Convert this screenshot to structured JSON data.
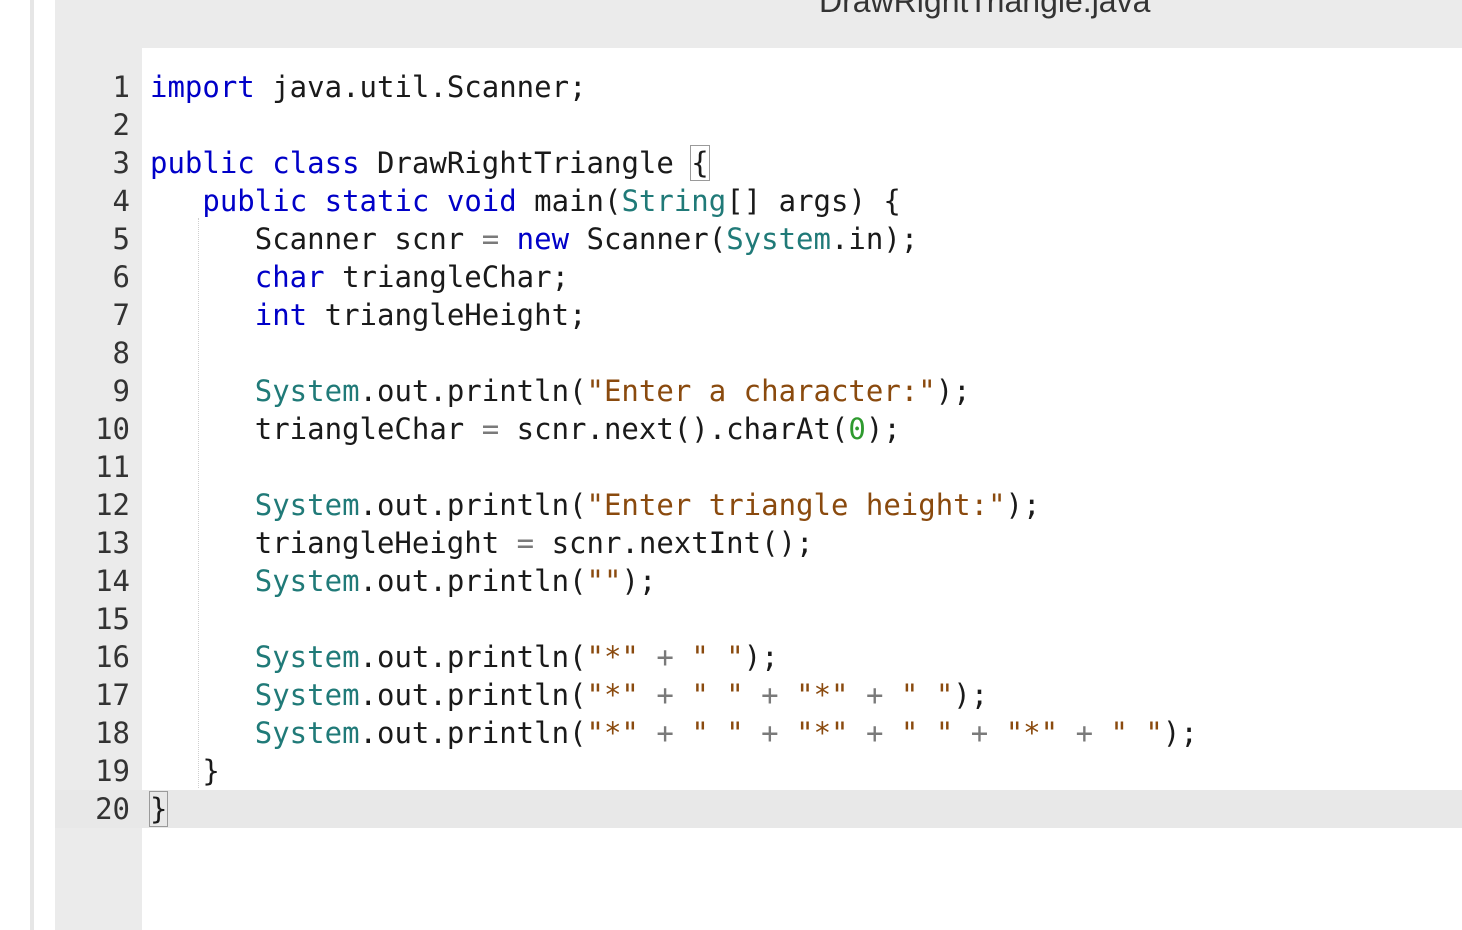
{
  "editor": {
    "file_title": "DrawRightTriangle.java",
    "active_line": 20
  },
  "lines": [
    {
      "num": "1",
      "tokens": [
        [
          "kw",
          "import"
        ],
        [
          "p",
          " java.util.Scanner;"
        ]
      ]
    },
    {
      "num": "2",
      "tokens": []
    },
    {
      "num": "3",
      "tokens": [
        [
          "kw",
          "public"
        ],
        [
          "p",
          " "
        ],
        [
          "kw",
          "class"
        ],
        [
          "p",
          " DrawRightTriangle "
        ],
        [
          "br",
          "{"
        ]
      ]
    },
    {
      "num": "4",
      "tokens": [
        [
          "p",
          "   "
        ],
        [
          "kw",
          "public"
        ],
        [
          "p",
          " "
        ],
        [
          "kw",
          "static"
        ],
        [
          "p",
          " "
        ],
        [
          "kw",
          "void"
        ],
        [
          "p",
          " main("
        ],
        [
          "ty",
          "String"
        ],
        [
          "p",
          "[] args) {"
        ]
      ]
    },
    {
      "num": "5",
      "tokens": [
        [
          "p",
          "      Scanner scnr "
        ],
        [
          "op",
          "="
        ],
        [
          "p",
          " "
        ],
        [
          "kw",
          "new"
        ],
        [
          "p",
          " Scanner("
        ],
        [
          "ty",
          "System"
        ],
        [
          "p",
          ".in);"
        ]
      ]
    },
    {
      "num": "6",
      "tokens": [
        [
          "p",
          "      "
        ],
        [
          "kw",
          "char"
        ],
        [
          "p",
          " triangleChar;"
        ]
      ]
    },
    {
      "num": "7",
      "tokens": [
        [
          "p",
          "      "
        ],
        [
          "kw",
          "int"
        ],
        [
          "p",
          " triangleHeight;"
        ]
      ]
    },
    {
      "num": "8",
      "tokens": []
    },
    {
      "num": "9",
      "tokens": [
        [
          "p",
          "      "
        ],
        [
          "ty",
          "System"
        ],
        [
          "p",
          ".out.println("
        ],
        [
          "st",
          "\"Enter a character:\""
        ],
        [
          "p",
          ");"
        ]
      ]
    },
    {
      "num": "10",
      "tokens": [
        [
          "p",
          "      triangleChar "
        ],
        [
          "op",
          "="
        ],
        [
          "p",
          " scnr.next().charAt("
        ],
        [
          "nu",
          "0"
        ],
        [
          "p",
          ");"
        ]
      ]
    },
    {
      "num": "11",
      "tokens": []
    },
    {
      "num": "12",
      "tokens": [
        [
          "p",
          "      "
        ],
        [
          "ty",
          "System"
        ],
        [
          "p",
          ".out.println("
        ],
        [
          "st",
          "\"Enter triangle height:\""
        ],
        [
          "p",
          ");"
        ]
      ]
    },
    {
      "num": "13",
      "tokens": [
        [
          "p",
          "      triangleHeight "
        ],
        [
          "op",
          "="
        ],
        [
          "p",
          " scnr.nextInt();"
        ]
      ]
    },
    {
      "num": "14",
      "tokens": [
        [
          "p",
          "      "
        ],
        [
          "ty",
          "System"
        ],
        [
          "p",
          ".out.println("
        ],
        [
          "st",
          "\"\""
        ],
        [
          "p",
          ");"
        ]
      ]
    },
    {
      "num": "15",
      "tokens": []
    },
    {
      "num": "16",
      "tokens": [
        [
          "p",
          "      "
        ],
        [
          "ty",
          "System"
        ],
        [
          "p",
          ".out.println("
        ],
        [
          "st",
          "\"*\""
        ],
        [
          "p",
          " "
        ],
        [
          "op",
          "+"
        ],
        [
          "p",
          " "
        ],
        [
          "st",
          "\" \""
        ],
        [
          "p",
          ");"
        ]
      ]
    },
    {
      "num": "17",
      "tokens": [
        [
          "p",
          "      "
        ],
        [
          "ty",
          "System"
        ],
        [
          "p",
          ".out.println("
        ],
        [
          "st",
          "\"*\""
        ],
        [
          "p",
          " "
        ],
        [
          "op",
          "+"
        ],
        [
          "p",
          " "
        ],
        [
          "st",
          "\" \""
        ],
        [
          "p",
          " "
        ],
        [
          "op",
          "+"
        ],
        [
          "p",
          " "
        ],
        [
          "st",
          "\"*\""
        ],
        [
          "p",
          " "
        ],
        [
          "op",
          "+"
        ],
        [
          "p",
          " "
        ],
        [
          "st",
          "\" \""
        ],
        [
          "p",
          ");"
        ]
      ]
    },
    {
      "num": "18",
      "tokens": [
        [
          "p",
          "      "
        ],
        [
          "ty",
          "System"
        ],
        [
          "p",
          ".out.println("
        ],
        [
          "st",
          "\"*\""
        ],
        [
          "p",
          " "
        ],
        [
          "op",
          "+"
        ],
        [
          "p",
          " "
        ],
        [
          "st",
          "\" \""
        ],
        [
          "p",
          " "
        ],
        [
          "op",
          "+"
        ],
        [
          "p",
          " "
        ],
        [
          "st",
          "\"*\""
        ],
        [
          "p",
          " "
        ],
        [
          "op",
          "+"
        ],
        [
          "p",
          " "
        ],
        [
          "st",
          "\" \""
        ],
        [
          "p",
          " "
        ],
        [
          "op",
          "+"
        ],
        [
          "p",
          " "
        ],
        [
          "st",
          "\"*\""
        ],
        [
          "p",
          " "
        ],
        [
          "op",
          "+"
        ],
        [
          "p",
          " "
        ],
        [
          "st",
          "\" \""
        ],
        [
          "p",
          ");"
        ]
      ]
    },
    {
      "num": "19",
      "tokens": [
        [
          "p",
          "   }"
        ]
      ]
    },
    {
      "num": "20",
      "tokens": [
        [
          "cur",
          "}"
        ]
      ]
    }
  ]
}
